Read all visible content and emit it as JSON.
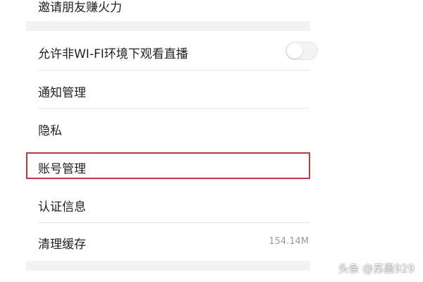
{
  "settings": {
    "items": [
      {
        "label": "邀请朋友赚火力"
      },
      {
        "label": "允许非WI-FI环境下观看直播",
        "toggle_state": "off"
      },
      {
        "label": "通知管理"
      },
      {
        "label": "隐私"
      },
      {
        "label": "账号管理",
        "highlighted": true
      },
      {
        "label": "认证信息"
      },
      {
        "label": "清理缓存",
        "value": "154.14M"
      }
    ]
  },
  "colors": {
    "highlight": "#c0383f",
    "section_gap": "#f2f2f2",
    "text": "#222222",
    "value_text": "#9a9a9a"
  },
  "icons": [
    "toggle-switch-icon"
  ],
  "watermark": "头条 @苏墨929"
}
